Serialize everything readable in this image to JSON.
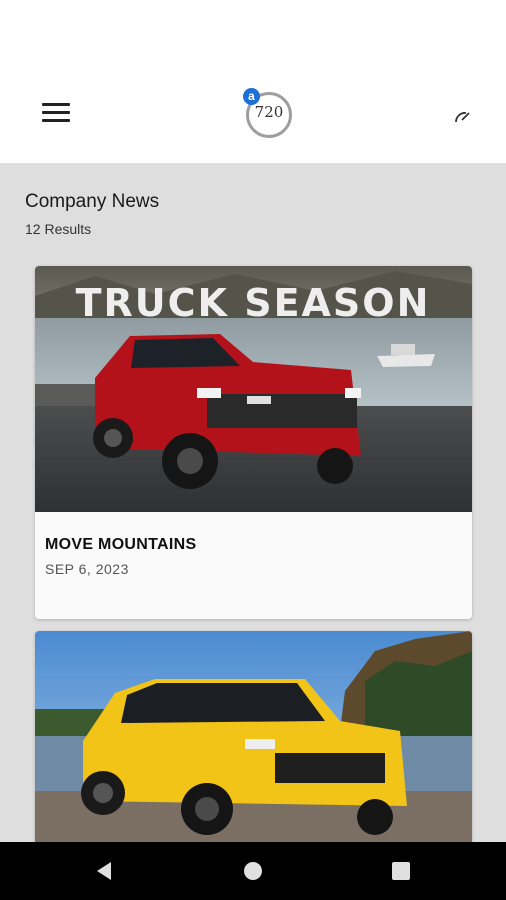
{
  "app": {
    "logo_number": "720",
    "logo_badge": "a"
  },
  "section": {
    "title": "Company News",
    "results": "12 Results"
  },
  "cards": [
    {
      "image_headline": "TRUCK SEASON",
      "title": "MOVE MOUNTAINS",
      "date": "SEP 6, 2023"
    },
    {
      "image_headline": "",
      "title": "",
      "date": ""
    }
  ],
  "icons": {
    "menu": "menu-icon",
    "gauge": "gauge-icon",
    "back": "back-icon",
    "home": "home-icon",
    "recents": "recents-icon"
  },
  "colors": {
    "background": "#dedede",
    "app_bar": "#ffffff",
    "logo_badge": "#1e6fd6",
    "truck_red": "#c4161c",
    "suv_yellow": "#f2c418"
  }
}
